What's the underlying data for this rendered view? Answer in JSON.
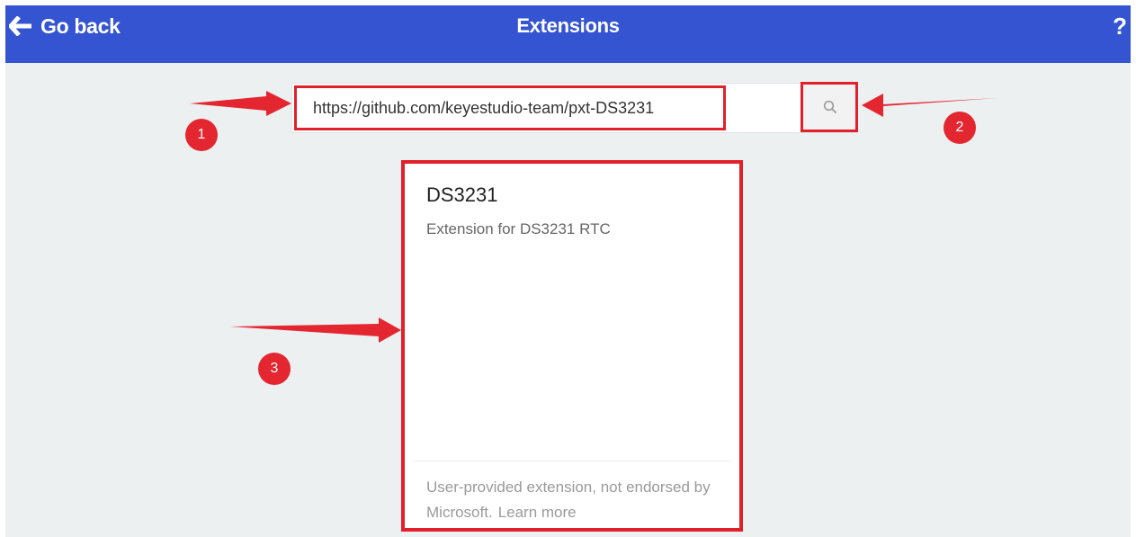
{
  "header": {
    "back_label": "Go back",
    "title": "Extensions",
    "help_label": "?"
  },
  "search": {
    "value": "https://github.com/keyestudio-team/pxt-DS3231",
    "button_icon": "search-icon"
  },
  "result_card": {
    "title": "DS3231",
    "description": "Extension for DS3231 RTC",
    "footer_text": "User-provided extension, not endorsed by Microsoft.",
    "learn_more": "Learn more"
  },
  "annotations": {
    "badges": [
      "1",
      "2",
      "3"
    ]
  },
  "colors": {
    "header_bg": "#3454d1",
    "page_bg": "#ecf0f1",
    "highlight": "#e0202a"
  }
}
